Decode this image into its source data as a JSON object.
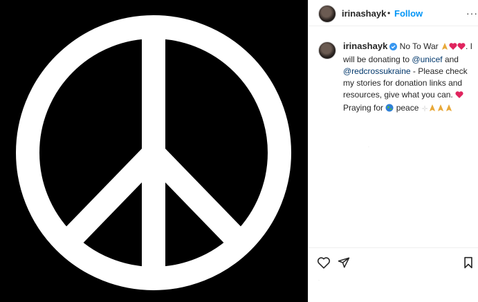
{
  "post": {
    "username": "irinashayk",
    "separator": "•",
    "follow_label": "Follow",
    "more_label": "···",
    "caption": {
      "username": "irinashayk",
      "text_1": " No To War ",
      "text_2": ". I will be donating to ",
      "mention_1": "@unicef",
      "text_3": " and ",
      "mention_2": "@redcrossukraine",
      "text_4": " - Please check my stories for donation links and resources, give what you can. ",
      "text_5": " Praying for ",
      "text_6": " peace "
    },
    "faint_marker": "·"
  },
  "media": {
    "background": "#000000",
    "symbol": "peace-symbol",
    "symbol_color": "#ffffff"
  },
  "colors": {
    "accent": "#0095f6",
    "mention": "#00376b",
    "heart": "#e0245e"
  },
  "icons": {
    "like": "heart-outline-icon",
    "share": "paper-plane-icon",
    "save": "bookmark-icon"
  }
}
